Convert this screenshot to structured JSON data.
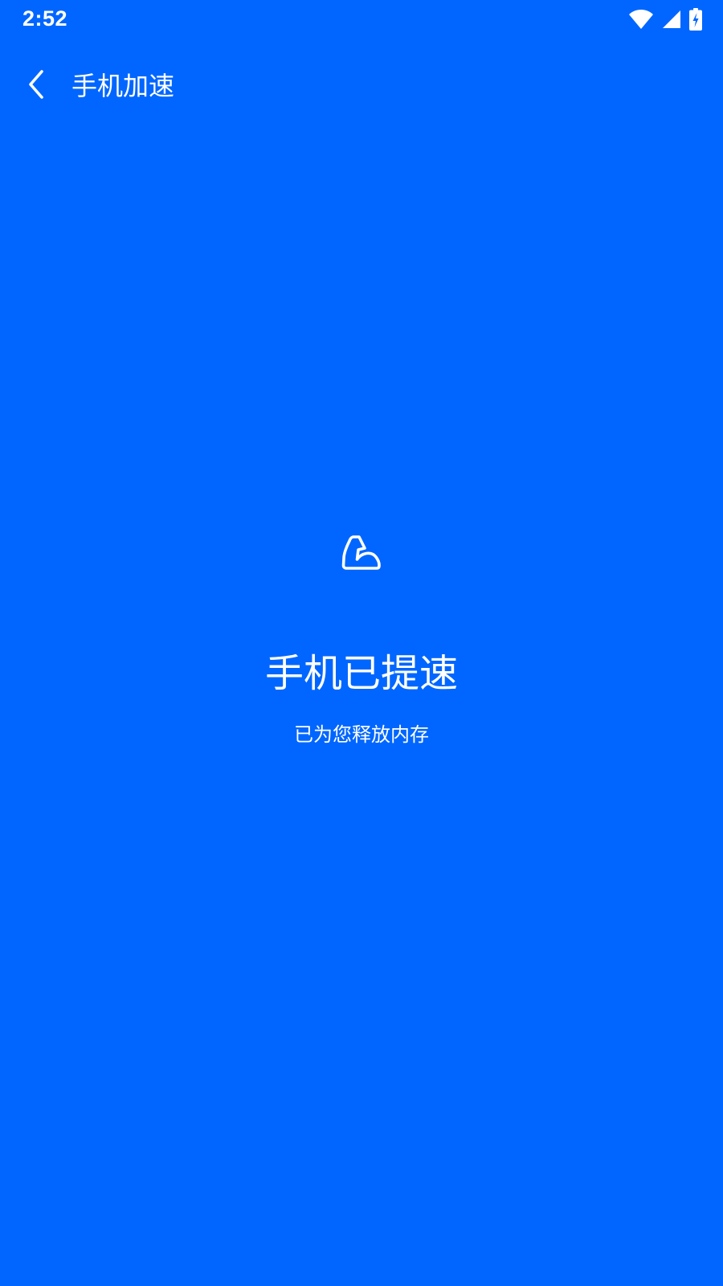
{
  "status_bar": {
    "time": "2:52",
    "icons": [
      "wifi-icon",
      "cellular-signal-icon",
      "battery-charging-icon"
    ]
  },
  "app_bar": {
    "back_icon": "chevron-left-icon",
    "title": "手机加速"
  },
  "result": {
    "icon": "flexed-arm-icon",
    "title": "手机已提速",
    "subtitle": "已为您释放内存"
  },
  "colors": {
    "background": "#0066FF",
    "foreground": "#FFFFFF"
  }
}
